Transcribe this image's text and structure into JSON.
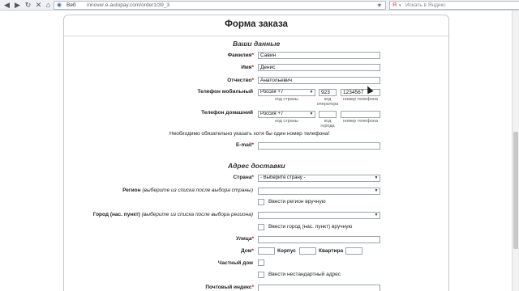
{
  "browser": {
    "site_name": "Веб",
    "url": "innover.e-autopay.com/order1/39_3",
    "search_placeholder": "Искать в Яндекс"
  },
  "form": {
    "title": "Форма заказа",
    "personal_section": "Ваши данные",
    "surname_label": "Фамилия",
    "surname_value": "Савин",
    "name_label": "Имя",
    "name_value": "Денис",
    "patronymic_label": "Отчество",
    "patronymic_value": "Анатольевич",
    "mobile_label": "Телефон мобильный",
    "mobile_country": "Россия +7",
    "mobile_code": "923",
    "mobile_number": "1234567",
    "home_label": "Телефон домашний",
    "home_country": "Россия +7",
    "home_code": "",
    "home_number": "",
    "sub_country_code": "код страны",
    "sub_operator_code_1": "код",
    "sub_operator_code_2": "оператора",
    "sub_phone_number": "номер телефона",
    "sub_city_code_1": "код",
    "sub_city_code_2": "города",
    "phone_note": "Необходимо обязательно указать хотя бы один номер телефона!",
    "email_label": "E-mail",
    "email_value": "",
    "required_mark": "*"
  },
  "address": {
    "section": "Адрес доставки",
    "country_label": "Страна",
    "country_value": "- Выберите страну -",
    "region_label": "Регион",
    "region_hint": "(выберите из списка после выбора страны)",
    "region_value": "",
    "region_manual": "Ввести регион вручную",
    "city_label": "Город (нас. пункт)",
    "city_hint": "(выберите из списка после выбора региона)",
    "city_value": "",
    "city_manual": "Ввести город (нас. пункт) вручную",
    "street_label": "Улица",
    "house_label": "Дом",
    "block_label": "Корпус",
    "flat_label": "Квартира",
    "private_house_label": "Частный дом",
    "nonstandard_address": "Ввести нестандартный адрес",
    "postcode_label": "Почтовый индекс"
  }
}
